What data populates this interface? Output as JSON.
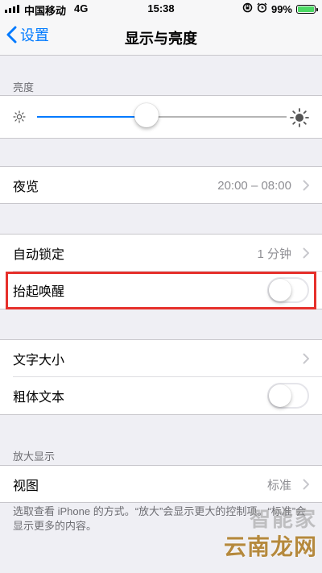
{
  "status_bar": {
    "carrier": "中国移动",
    "network": "4G",
    "time": "15:38",
    "battery": "99%",
    "battery_level": 0.99,
    "icons": [
      "lock-rotation-icon",
      "alarm-icon"
    ]
  },
  "nav": {
    "back_label": "设置",
    "title": "显示与亮度"
  },
  "brightness": {
    "header": "亮度",
    "level": 0.44
  },
  "night_shift": {
    "label": "夜览",
    "value": "20:00 – 08:00"
  },
  "auto_lock": {
    "label": "自动锁定",
    "value": "1 分钟"
  },
  "raise_to_wake": {
    "label": "抬起唤醒",
    "on": false
  },
  "text_size": {
    "label": "文字大小"
  },
  "bold_text": {
    "label": "粗体文本",
    "on": false
  },
  "zoom": {
    "header": "放大显示",
    "view_label": "视图",
    "view_value": "标准",
    "footer": "选取查看 iPhone 的方式。“放大”会显示更大的控制项。“标准”会显示更多的内容。"
  },
  "watermark": {
    "line1": "智能家",
    "line2": "云南龙网"
  },
  "colors": {
    "accent": "#007aff",
    "highlight": "#e6302b",
    "background": "#efeff4"
  }
}
